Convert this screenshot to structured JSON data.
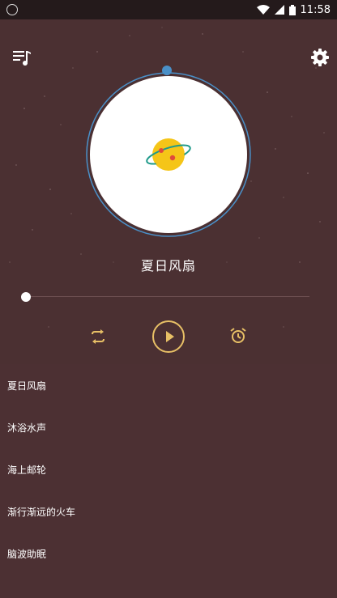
{
  "status_bar": {
    "time": "11:58",
    "icons": [
      "sync-icon",
      "wifi-icon",
      "signal-icon",
      "battery-icon"
    ]
  },
  "header": {
    "playlist_icon": "playlist-music-icon",
    "settings_icon": "gear-icon"
  },
  "now_playing": {
    "title": "夏日风扇",
    "progress": 0
  },
  "controls": {
    "repeat_icon": "repeat-icon",
    "play_icon": "play-icon",
    "timer_icon": "alarm-clock-icon"
  },
  "playlist": {
    "items": [
      {
        "label": "夏日风扇"
      },
      {
        "label": "沐浴水声"
      },
      {
        "label": "海上邮轮"
      },
      {
        "label": "渐行渐远的火车"
      },
      {
        "label": "脑波助眠"
      }
    ]
  },
  "colors": {
    "background": "#4b3032",
    "accent": "#e8c066",
    "ring": "#4a90c8",
    "planet": "#f5c518"
  }
}
